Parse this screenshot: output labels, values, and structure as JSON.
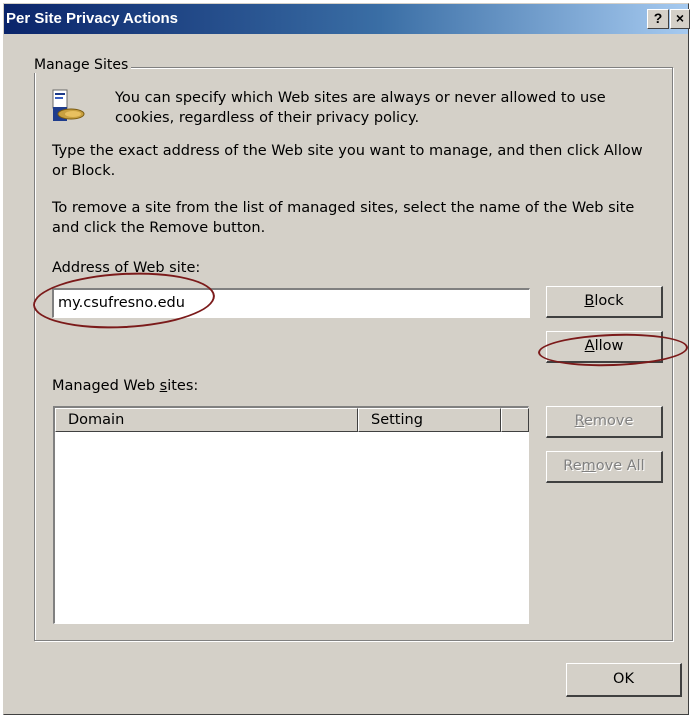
{
  "window": {
    "title": "Per Site Privacy Actions",
    "help_button": "?",
    "close_button": "×"
  },
  "group": {
    "legend": "Manage Sites"
  },
  "intro": {
    "line1": "You can specify which Web sites are always or never allowed to use",
    "line2": "cookies, regardless of their privacy policy."
  },
  "instructions": {
    "p1_line1": "Type the exact address of the Web site you want to manage, and then click Allow",
    "p1_line2": "or Block.",
    "p2_line1": "To remove a site from the list of managed sites, select the name of the Web site",
    "p2_line2": "and click the Remove button."
  },
  "address": {
    "label_pre": "Address of ",
    "label_mnemonic": "W",
    "label_post": "eb site:",
    "value": "my.csufresno.edu"
  },
  "buttons": {
    "block_mnemonic": "B",
    "block_rest": "lock",
    "allow_mnemonic": "A",
    "allow_rest": "llow",
    "remove_mnemonic": "R",
    "remove_rest": "emove",
    "remove_all_pre": "Re",
    "remove_all_mnemonic": "m",
    "remove_all_post": "ove All",
    "ok": "OK"
  },
  "managed": {
    "label_pre": "Managed Web ",
    "label_mnemonic": "s",
    "label_post": "ites:",
    "columns": [
      "Domain",
      "Setting"
    ],
    "rows": []
  },
  "icon_name": "privacy-cookie-icon",
  "annotation_color": "#7b1a1a"
}
